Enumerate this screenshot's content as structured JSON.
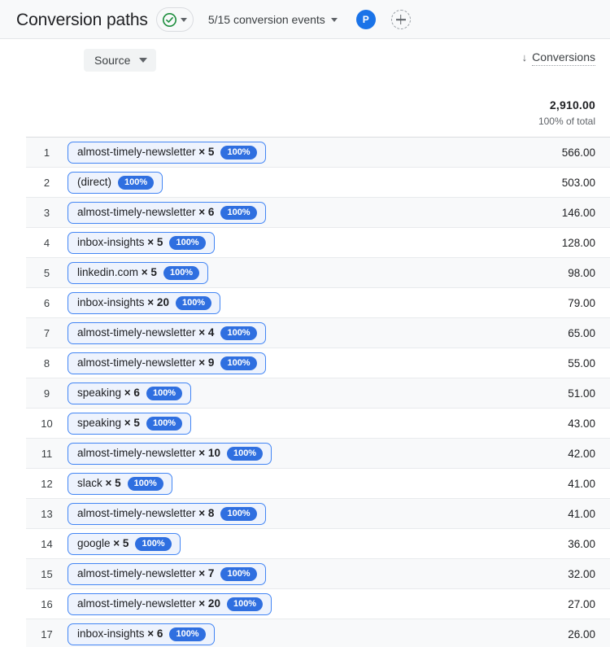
{
  "header": {
    "title": "Conversion paths",
    "status_icon": "green-check-circle-icon",
    "status_caret_icon": "chevron-down-icon",
    "events_label": "5/15 conversion events",
    "events_caret_icon": "chevron-down-icon",
    "avatar_initial": "P",
    "add_user_icon": "plus-icon",
    "accent_color": "#1a73e8",
    "status_color": "#1e8e3e"
  },
  "table": {
    "dimension_header": {
      "label": "Source",
      "caret_icon": "chevron-down-icon"
    },
    "metric_header": {
      "sort_arrow": "↓",
      "label": "Conversions",
      "total": "2,910.00",
      "subtotal": "100% of total"
    },
    "rows": [
      {
        "index": "1",
        "source": "almost-timely-newsletter",
        "multiplier": "× 5",
        "pct": "100%",
        "conversions": "566.00"
      },
      {
        "index": "2",
        "source": "(direct)",
        "multiplier": "",
        "pct": "100%",
        "conversions": "503.00"
      },
      {
        "index": "3",
        "source": "almost-timely-newsletter",
        "multiplier": "× 6",
        "pct": "100%",
        "conversions": "146.00"
      },
      {
        "index": "4",
        "source": "inbox-insights",
        "multiplier": "× 5",
        "pct": "100%",
        "conversions": "128.00"
      },
      {
        "index": "5",
        "source": "linkedin.com",
        "multiplier": "× 5",
        "pct": "100%",
        "conversions": "98.00"
      },
      {
        "index": "6",
        "source": "inbox-insights",
        "multiplier": "× 20",
        "pct": "100%",
        "conversions": "79.00"
      },
      {
        "index": "7",
        "source": "almost-timely-newsletter",
        "multiplier": "× 4",
        "pct": "100%",
        "conversions": "65.00"
      },
      {
        "index": "8",
        "source": "almost-timely-newsletter",
        "multiplier": "× 9",
        "pct": "100%",
        "conversions": "55.00"
      },
      {
        "index": "9",
        "source": "speaking",
        "multiplier": "× 6",
        "pct": "100%",
        "conversions": "51.00"
      },
      {
        "index": "10",
        "source": "speaking",
        "multiplier": "× 5",
        "pct": "100%",
        "conversions": "43.00"
      },
      {
        "index": "11",
        "source": "almost-timely-newsletter",
        "multiplier": "× 10",
        "pct": "100%",
        "conversions": "42.00"
      },
      {
        "index": "12",
        "source": "slack",
        "multiplier": "× 5",
        "pct": "100%",
        "conversions": "41.00"
      },
      {
        "index": "13",
        "source": "almost-timely-newsletter",
        "multiplier": "× 8",
        "pct": "100%",
        "conversions": "41.00"
      },
      {
        "index": "14",
        "source": "google",
        "multiplier": "× 5",
        "pct": "100%",
        "conversions": "36.00"
      },
      {
        "index": "15",
        "source": "almost-timely-newsletter",
        "multiplier": "× 7",
        "pct": "100%",
        "conversions": "32.00"
      },
      {
        "index": "16",
        "source": "almost-timely-newsletter",
        "multiplier": "× 20",
        "pct": "100%",
        "conversions": "27.00"
      },
      {
        "index": "17",
        "source": "inbox-insights",
        "multiplier": "× 6",
        "pct": "100%",
        "conversions": "26.00"
      }
    ]
  }
}
